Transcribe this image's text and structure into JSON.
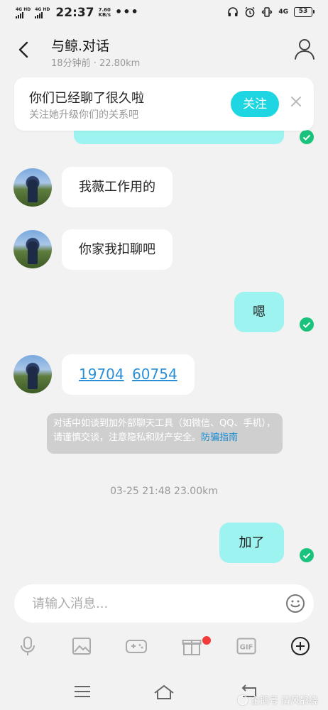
{
  "status_bar": {
    "signal_1_label": "4G HD",
    "signal_2_label": "4G HD",
    "time": "22:37",
    "speed_value": "7.60",
    "speed_unit": "KB/s",
    "more": "•••",
    "network_label": "4G",
    "battery": "53"
  },
  "header": {
    "title": "与鲸.对话",
    "subtitle": "18分钟前 · 22.80km"
  },
  "banner": {
    "title": "你们已经聊了很久啦",
    "subtitle": "关注她升级你们的关系吧",
    "follow_label": "关注"
  },
  "messages": [
    {
      "side": "incoming",
      "text": "我薇工作用的"
    },
    {
      "side": "incoming",
      "text": "你家我扣聊吧"
    },
    {
      "side": "outgoing",
      "text": "嗯"
    },
    {
      "side": "incoming",
      "phone_parts": [
        "19704",
        "60754"
      ]
    },
    {
      "side": "outgoing",
      "text": "加了"
    }
  ],
  "warning": {
    "text": "对话中如谈到加外部聊天工具（如微信、QQ、手机），请谨慎交谈，注意隐私和财产安全。",
    "link_text": "防骗指南"
  },
  "timestamp": "03-25 21:48  23.00km",
  "input": {
    "placeholder": "请输入消息..."
  },
  "toolbar": {
    "gif_label": "GIF"
  },
  "watermark": {
    "text": "企鹅号 清风鹊绕"
  },
  "colors": {
    "accent": "#1ed6e1",
    "outgoing_bubble": "#9cf3ef",
    "check_green": "#19c37d",
    "link_blue": "#2a8fd6",
    "badge_red": "#f23b3b"
  }
}
